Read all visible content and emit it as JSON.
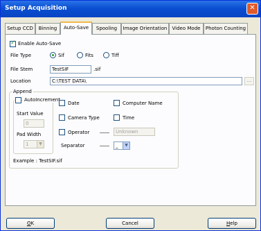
{
  "window": {
    "title": "Setup Acquisition",
    "close_label": "✕"
  },
  "tabs": [
    {
      "label": "Setup CCD"
    },
    {
      "label": "Binning"
    },
    {
      "label": "Auto-Save"
    },
    {
      "label": "Spooling"
    },
    {
      "label": "Image Orientation"
    },
    {
      "label": "Video Mode"
    },
    {
      "label": "Photon Counting"
    }
  ],
  "active_tab": "Auto-Save",
  "autosave": {
    "enable_label": "Enable Auto-Save",
    "enable_checked": true,
    "file_type_label": "File Type",
    "file_types": [
      {
        "label": "Sif",
        "checked": true
      },
      {
        "label": "Fits",
        "checked": false
      },
      {
        "label": "Tiff",
        "checked": false
      }
    ],
    "file_stem_label": "File Stem",
    "file_stem_value": "TestSIF",
    "file_ext": ".sif",
    "location_label": "Location",
    "location_value": "C:\\TEST DATA\\",
    "browse_label": "..."
  },
  "append": {
    "group_label": "Append",
    "autoincrement_label": "AutoIncrement",
    "autoincrement_checked": false,
    "start_value_label": "Start Value",
    "start_value": "0",
    "pad_width_label": "Pad Width",
    "pad_width_value": "1",
    "date_label": "Date",
    "computer_name_label": "Computer Name",
    "camera_type_label": "Camera Type",
    "time_label": "Time",
    "operator_label": "Operator",
    "operator_value": "Unknown",
    "separator_label": "Separator",
    "separator_value": "_",
    "example_label": "Example : TestSIF.sif"
  },
  "buttons": {
    "ok_mnemonic": "O",
    "ok_rest": "K",
    "cancel_label": "Cancel",
    "help_mnemonic": "H",
    "help_rest": "elp"
  }
}
